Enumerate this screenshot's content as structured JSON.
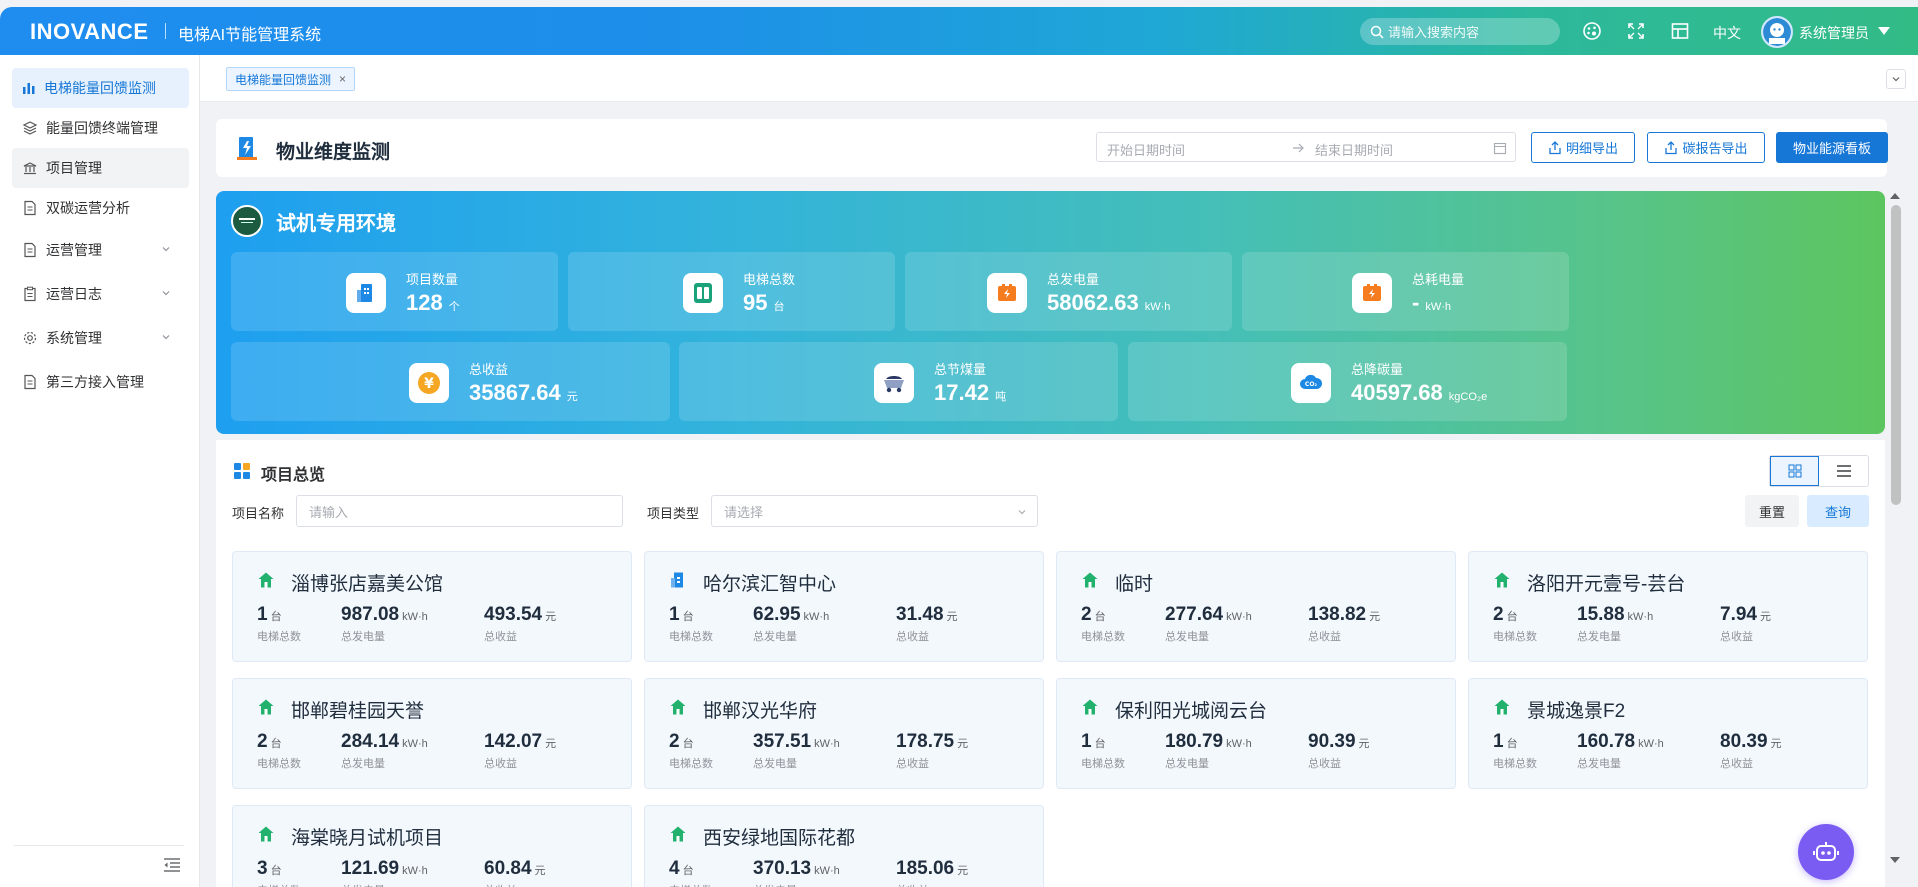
{
  "header": {
    "brand": "INOVANCE",
    "app_title": "电梯AI节能管理系统",
    "search_placeholder": "请输入搜索内容",
    "language": "中文",
    "user_name": "系统管理员"
  },
  "sidebar": {
    "items": [
      {
        "label": "电梯能量回馈监测",
        "icon": "bar-chart-icon"
      },
      {
        "label": "能量回馈终端管理",
        "icon": "layers-icon"
      },
      {
        "label": "项目管理",
        "icon": "bank-icon"
      },
      {
        "label": "双碳运营分析",
        "icon": "document-icon"
      },
      {
        "label": "运营管理",
        "icon": "document-icon"
      },
      {
        "label": "运营日志",
        "icon": "clipboard-icon"
      },
      {
        "label": "系统管理",
        "icon": "gear-icon"
      },
      {
        "label": "第三方接入管理",
        "icon": "document-icon"
      }
    ]
  },
  "tabs": [
    {
      "label": "电梯能量回馈监测"
    }
  ],
  "page": {
    "title": "物业维度监测",
    "start_date_placeholder": "开始日期时间",
    "end_date_placeholder": "结束日期时间",
    "btn_detail_export": "明细导出",
    "btn_carbon_export": "碳报告导出",
    "btn_dashboard": "物业能源看板"
  },
  "banner": {
    "env_title": "试机专用环境",
    "stats_row1": [
      {
        "label": "项目数量",
        "value": "128",
        "unit": "个",
        "icon": "building-icon",
        "color": "#1e88e5"
      },
      {
        "label": "电梯总数",
        "value": "95",
        "unit": "台",
        "icon": "elevator-icon",
        "color": "#1aa37a"
      },
      {
        "label": "总发电量",
        "value": "58062.63",
        "unit": "kW·h",
        "icon": "battery-charge-icon",
        "color": "#f57c1f"
      },
      {
        "label": "总耗电量",
        "value": "-",
        "unit": "kW·h",
        "icon": "battery-consume-icon",
        "color": "#f57c1f"
      }
    ],
    "stats_row2": [
      {
        "label": "总收益",
        "value": "35867.64",
        "unit": "元",
        "icon": "yuan-coin-icon",
        "color": "#f5a623"
      },
      {
        "label": "总节煤量",
        "value": "17.42",
        "unit": "吨",
        "icon": "coal-cart-icon",
        "color": "#2b3b66"
      },
      {
        "label": "总降碳量",
        "value": "40597.68",
        "unit": "kgCO₂e",
        "icon": "co2-cloud-icon",
        "color": "#1e88e5"
      }
    ]
  },
  "overview": {
    "title": "项目总览",
    "filter_name_label": "项目名称",
    "filter_name_placeholder": "请输入",
    "filter_type_label": "项目类型",
    "filter_type_placeholder": "请选择",
    "btn_reset": "重置",
    "btn_query": "查询",
    "metric_labels": {
      "elevators": "电梯总数",
      "power": "总发电量",
      "income": "总收益"
    },
    "units": {
      "elevators": "台",
      "power": "kW·h",
      "income": "元"
    },
    "projects": [
      {
        "name": "淄博张店嘉美公馆",
        "icon": "home-icon",
        "elevators": "1",
        "power": "987.08",
        "income": "493.54"
      },
      {
        "name": "哈尔滨汇智中心",
        "icon": "office-icon",
        "elevators": "1",
        "power": "62.95",
        "income": "31.48"
      },
      {
        "name": "临时",
        "icon": "home-icon",
        "elevators": "2",
        "power": "277.64",
        "income": "138.82"
      },
      {
        "name": "洛阳开元壹号-芸台",
        "icon": "home-icon",
        "elevators": "2",
        "power": "15.88",
        "income": "7.94"
      },
      {
        "name": "邯郸碧桂园天誉",
        "icon": "home-icon",
        "elevators": "2",
        "power": "284.14",
        "income": "142.07"
      },
      {
        "name": "邯郸汉光华府",
        "icon": "home-icon",
        "elevators": "2",
        "power": "357.51",
        "income": "178.75"
      },
      {
        "name": "保利阳光城阅云台",
        "icon": "home-icon",
        "elevators": "1",
        "power": "180.79",
        "income": "90.39"
      },
      {
        "name": "景城逸景F2",
        "icon": "home-icon",
        "elevators": "1",
        "power": "160.78",
        "income": "80.39"
      },
      {
        "name": "海棠晓月试机项目",
        "icon": "home-icon",
        "elevators": "3",
        "power": "121.69",
        "income": "60.84"
      },
      {
        "name": "西安绿地国际花都",
        "icon": "home-icon",
        "elevators": "4",
        "power": "370.13",
        "income": "185.06"
      }
    ]
  }
}
